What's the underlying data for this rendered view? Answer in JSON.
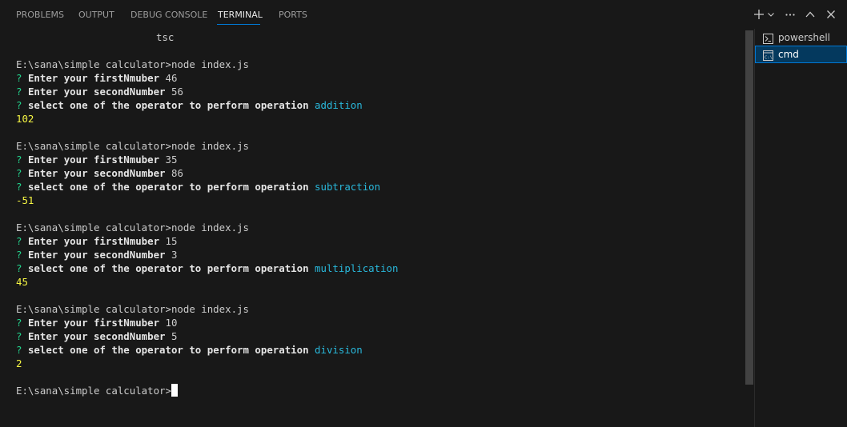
{
  "panel_tabs": [
    {
      "label": "PROBLEMS"
    },
    {
      "label": "OUTPUT"
    },
    {
      "label": "DEBUG CONSOLE"
    },
    {
      "label": "TERMINAL"
    },
    {
      "label": "PORTS"
    }
  ],
  "active_tab": "TERMINAL",
  "toolbar_icons": [
    "new-terminal-icon",
    "chevron-down-icon",
    "more-actions-icon",
    "maximize-panel-icon",
    "close-icon"
  ],
  "terminal": {
    "top_line": "tsc",
    "prompt": "E:\\sana\\simple calculator>",
    "command": "node index.js",
    "question_mark": "?",
    "q1": "Enter your firstNmuber",
    "q2": "Enter your secondNumber",
    "q3": "select one of the operator to perform operation",
    "runs": [
      {
        "first": "46",
        "second": "56",
        "operator": "addition",
        "result": "102"
      },
      {
        "first": "35",
        "second": "86",
        "operator": "subtraction",
        "result": "-51"
      },
      {
        "first": "15",
        "second": "3",
        "operator": "multiplication",
        "result": "45"
      },
      {
        "first": "10",
        "second": "5",
        "operator": "division",
        "result": "2"
      }
    ]
  },
  "terminal_list": [
    {
      "label": "powershell",
      "icon": "terminal-icon",
      "selected": false
    },
    {
      "label": "cmd",
      "icon": "cmd-icon",
      "selected": true
    }
  ],
  "colors": {
    "background": "#181818",
    "question_mark": "#23d18b",
    "operator": "#29b8db",
    "result": "#f5f543",
    "accent": "#0078d4"
  }
}
